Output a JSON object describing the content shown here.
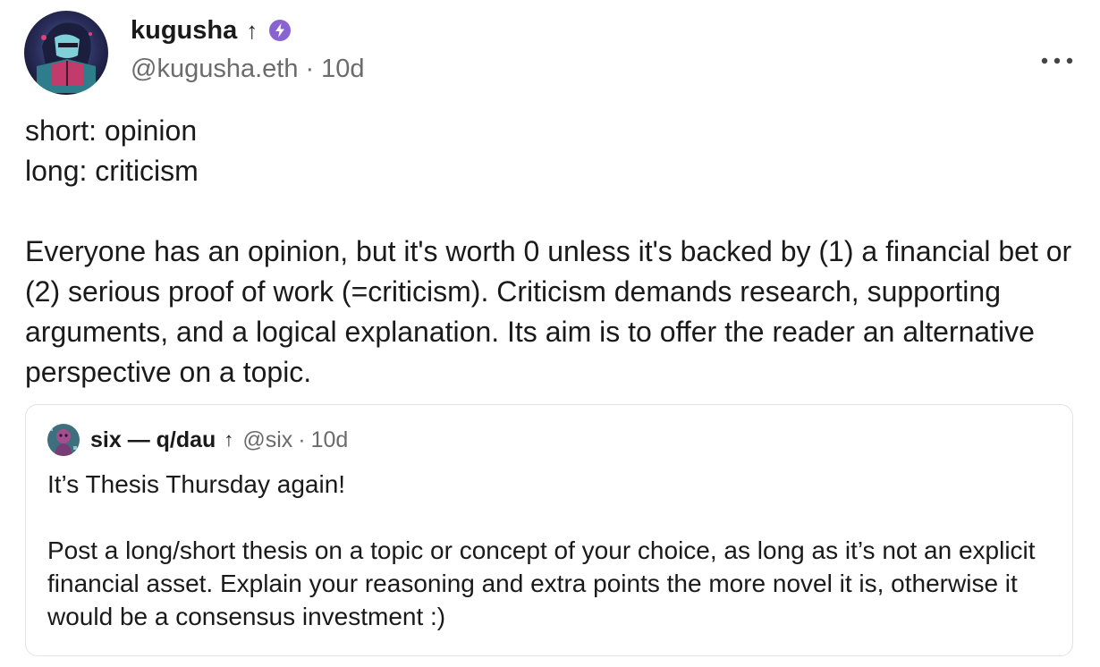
{
  "post": {
    "author": {
      "display_name": "kugusha",
      "handle": "@kugusha.eth",
      "time": "10d",
      "arrow_icon": "arrow-up-icon",
      "badge_icon": "power-badge-icon",
      "badge_color": "#8a63d2"
    },
    "more_icon": "more-horizontal-icon",
    "body": {
      "line1": "short: opinion",
      "line2": "long: criticism",
      "paragraph": "Everyone has an opinion, but it's worth 0 unless it's backed by (1) a financial bet or (2) serious proof of work (=criticism). Criticism demands research, supporting arguments, and a logical explanation. Its aim is to offer the reader an alternative perspective on a topic."
    },
    "quote": {
      "display_name": "six — q/dau",
      "handle": "@six",
      "time": "10d",
      "line1": "It’s Thesis Thursday again!",
      "paragraph": "Post a long/short thesis on a topic or concept of your choice, as long as it’s not an explicit financial asset. Explain your reasoning and extra points the more novel it is, otherwise it would be a consensus investment :)"
    }
  },
  "colors": {
    "text": "#1a1a1a",
    "muted": "#6b6b6b",
    "border": "#e3e3e3"
  }
}
